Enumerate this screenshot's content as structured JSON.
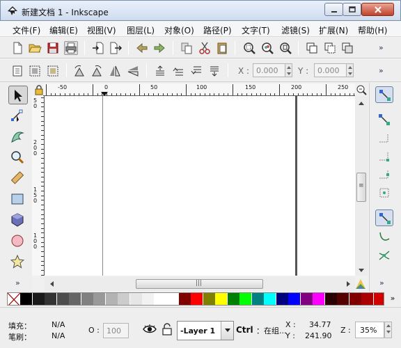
{
  "window": {
    "title": "新建文档 1 - Inkscape"
  },
  "menu": [
    "文件(F)",
    "编辑(E)",
    "视图(V)",
    "图层(L)",
    "对象(O)",
    "路径(P)",
    "文字(T)",
    "滤镜(S)",
    "扩展(N)",
    "帮助(H)"
  ],
  "commands_toolbar": {
    "more": "»",
    "icons": [
      "new-document-icon",
      "open-icon",
      "save-icon",
      "print-icon",
      "import-icon",
      "export-icon",
      "undo-icon",
      "redo-icon",
      "copy-icon",
      "cut-icon",
      "paste-icon",
      "zoom-selection-icon",
      "zoom-drawing-icon",
      "zoom-page-icon",
      "duplicate-icon",
      "clone-icon",
      "unlink-clone-icon"
    ]
  },
  "controls_toolbar": {
    "x_label": "X :",
    "x_value": "0.000",
    "y_label": "Y :",
    "y_value": "0.000",
    "more": "»",
    "icons": [
      "select-all-icon",
      "select-in-all-layers-icon",
      "deselect-icon",
      "rotate-ccw-icon",
      "rotate-cw-icon",
      "flip-horizontal-icon",
      "flip-vertical-icon",
      "raise-to-top-icon",
      "raise-icon",
      "lower-icon",
      "lower-to-bottom-icon"
    ]
  },
  "toolbox": {
    "more": "»",
    "tools": [
      "selector-tool",
      "node-tool",
      "tweak-tool",
      "zoom-tool",
      "measure-tool",
      "rectangle-tool",
      "3d-box-tool",
      "ellipse-tool",
      "star-tool"
    ],
    "active": "selector-tool"
  },
  "ruler": {
    "h_labels": [
      "-50",
      "0",
      "50",
      "100",
      "150",
      "200",
      "250"
    ],
    "v_labels": [
      "5",
      "0",
      "2",
      "0",
      "0",
      "1",
      "5",
      "0",
      "1",
      "0",
      "0"
    ]
  },
  "snap_toolbar": {
    "more": "»",
    "icons": [
      "snap-enable-icon",
      "snap-bbox-icon",
      "snap-bbox-edge-icon",
      "snap-bbox-corner-icon",
      "snap-bbox-midpoint-icon",
      "snap-bbox-center-icon",
      "snap-nodes-icon",
      "snap-path-icon",
      "snap-path-intersection-icon"
    ]
  },
  "palette": {
    "none_swatch": "none",
    "colors": [
      "#000000",
      "#1a1a1a",
      "#333333",
      "#4d4d4d",
      "#666666",
      "#808080",
      "#999999",
      "#b3b3b3",
      "#cccccc",
      "#e6e6e6",
      "#f2f2f2",
      "#ffffff",
      "#ffffff",
      "#800000",
      "#ff0000",
      "#808000",
      "#ffff00",
      "#008000",
      "#00ff00",
      "#008080",
      "#00ffff",
      "#000080",
      "#0000ff",
      "#800080",
      "#ff00ff",
      "#2b0000",
      "#550000",
      "#800000",
      "#aa0000",
      "#d40000"
    ],
    "more": "»"
  },
  "status": {
    "fill_label": "填充：",
    "fill_value": "N/A",
    "stroke_label": "笔刷：",
    "stroke_value": "N/A",
    "opacity_label": "O :",
    "opacity_value": "100",
    "layer_name": "-Layer 1",
    "message_bold": "Ctrl",
    "message_rest": "：在组...",
    "x_label": "X :",
    "x_value": "34.77",
    "y_label": "Y :",
    "y_value": "241.90",
    "zoom_label": "Z :",
    "zoom_value": "35%"
  }
}
